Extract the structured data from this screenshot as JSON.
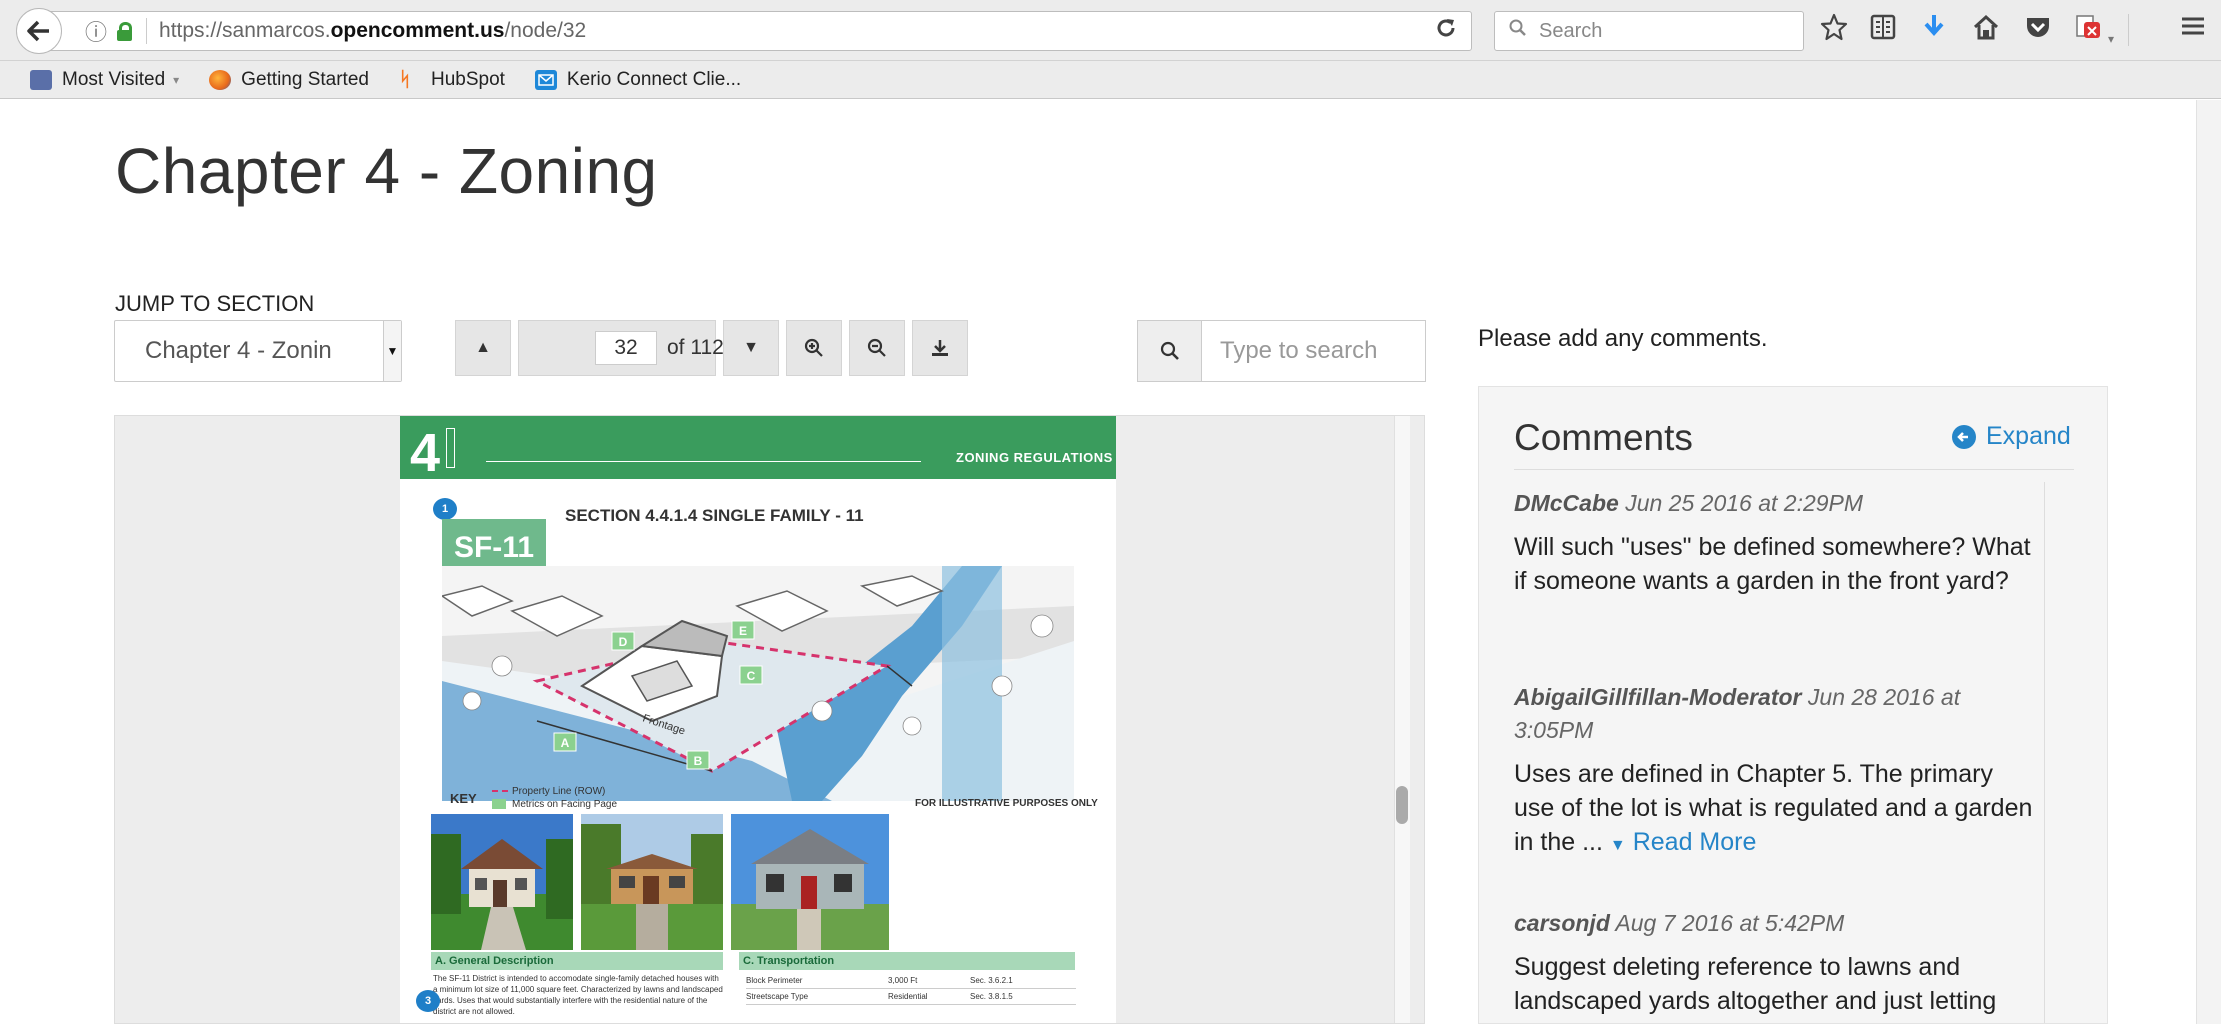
{
  "browser": {
    "url_prefix": "https://sanmarcos.",
    "url_domain": "opencomment.us",
    "url_suffix": "/node/32",
    "search_placeholder": "Search",
    "bookmarks": [
      {
        "label": "Most Visited",
        "icon": "bookmarks-folder-icon",
        "color": "#5a6fa8"
      },
      {
        "label": "Getting Started",
        "icon": "firefox-icon",
        "color": "#e8691c"
      },
      {
        "label": "HubSpot",
        "icon": "hubspot-icon",
        "color": "#f57722"
      },
      {
        "label": "Kerio Connect Clie...",
        "icon": "mail-icon",
        "color": "#1e88d8"
      }
    ]
  },
  "page": {
    "title": "Chapter 4 - Zoning",
    "jump_label": "JUMP TO SECTION",
    "jump_value": "Chapter 4 - Zonin",
    "page_current": "32",
    "page_of": "of 112",
    "search_placeholder": "Type to search"
  },
  "document": {
    "chapter_num": "4",
    "header_right": "ZONING REGULATIONS",
    "badge": "SF-11",
    "section_title": "SECTION 4.4.1.4  SINGLE FAMILY - 11",
    "bubble_1": "1",
    "bubble_3": "3",
    "key_label": "KEY",
    "key_line_1": "Property Line (ROW)",
    "key_line_2": "Metrics on Facing Page",
    "illus_note": "FOR ILLUSTRATIVE PURPOSES ONLY",
    "frontage": "Frontage",
    "markers": [
      "A",
      "B",
      "C",
      "D",
      "E"
    ],
    "table_a_title": "A. General Description",
    "table_a_text": "The SF-11 District is intended to accomodate single-family detached houses with a minimum lot size of 11,000 square feet. Characterized by lawns and landscaped yards. Uses that would substantially interfere with the residential nature of the district are not allowed.",
    "table_c_title": "C. Transportation",
    "table_c_rows": [
      [
        "Block Perimeter",
        "3,000 Ft",
        "Sec. 3.6.2.1"
      ],
      [
        "Streetscape Type",
        "Residential",
        "Sec. 3.8.1.5"
      ]
    ]
  },
  "comments": {
    "prompt": "Please add any comments.",
    "title": "Comments",
    "expand_label": "Expand",
    "read_more": "Read More",
    "items": [
      {
        "author": "DMcCabe",
        "date": "Jun 25 2016 at 2:29PM",
        "body": "Will such \"uses\" be defined somewhere? What if someone wants a garden in the front yard?"
      },
      {
        "author": "AbigailGillfillan-Moderator",
        "date": "Jun 28 2016 at 3:05PM",
        "body": "Uses are defined in Chapter 5. The primary use of the lot is what is regulated and a garden in the  ..."
      },
      {
        "author": "carsonjd",
        "date": "Aug 7 2016 at 5:42PM",
        "body": "Suggest deleting reference to lawns and landscaped yards altogether and just letting the Landscaping  ..."
      }
    ]
  }
}
